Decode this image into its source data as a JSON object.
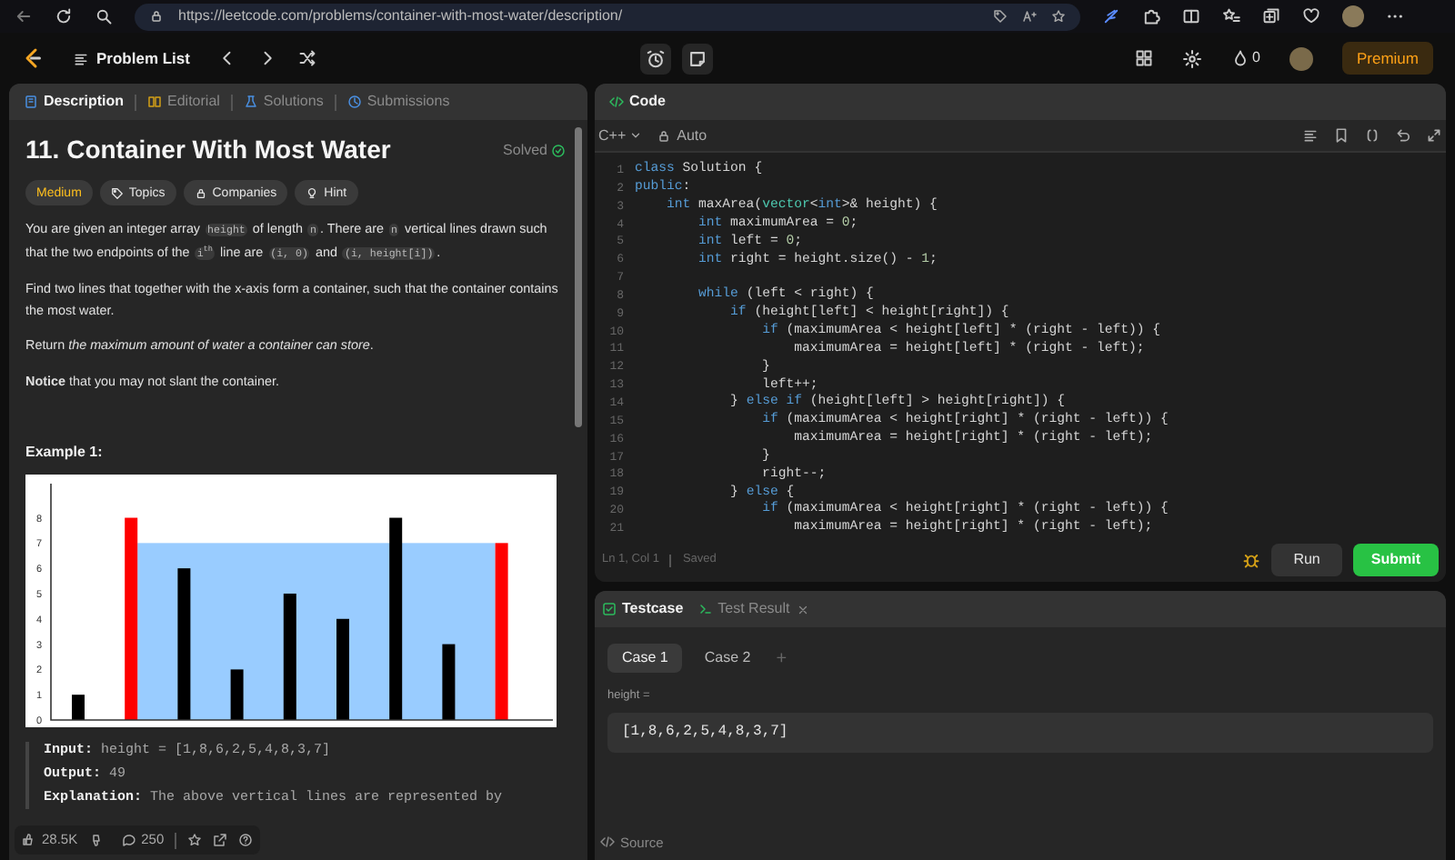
{
  "browser": {
    "url": "https://leetcode.com/problems/container-with-most-water/description/"
  },
  "nav": {
    "problem_list": "Problem List",
    "streak": "0",
    "premium": "Premium"
  },
  "description_tabs": [
    {
      "label": "Description",
      "selected": true
    },
    {
      "label": "Editorial",
      "selected": false
    },
    {
      "label": "Solutions",
      "selected": false
    },
    {
      "label": "Submissions",
      "selected": false
    }
  ],
  "problem": {
    "title": "11. Container With Most Water",
    "status": "Solved",
    "tags": [
      {
        "label": "Medium",
        "kind": "difficulty"
      },
      {
        "label": "Topics",
        "kind": "tag"
      },
      {
        "label": "Companies",
        "kind": "tag"
      },
      {
        "label": "Hint",
        "kind": "tag"
      }
    ],
    "paragraphs": [
      [
        {
          "kind": "text",
          "text": "You are given an integer array "
        },
        {
          "kind": "code",
          "text": "height"
        },
        {
          "kind": "text",
          "text": " of length "
        },
        {
          "kind": "code",
          "text": "n"
        },
        {
          "kind": "text",
          "text": ". There are "
        },
        {
          "kind": "code",
          "text": "n"
        },
        {
          "kind": "text",
          "text": " vertical lines drawn such that the two endpoints of the "
        },
        {
          "kind": "code",
          "text": "i$^{th}$"
        },
        {
          "kind": "text",
          "text": " line are "
        },
        {
          "kind": "code",
          "text": "(i, 0)"
        },
        {
          "kind": "text",
          "text": " and "
        },
        {
          "kind": "code",
          "text": "(i, height[i])"
        },
        {
          "kind": "text",
          "text": "."
        }
      ],
      [
        {
          "kind": "text",
          "text": "Find two lines that together with the x-axis form a container, such that the container contains the most water."
        }
      ],
      [
        {
          "kind": "text",
          "text": "Return *the maximum amount of water a container can store*."
        }
      ],
      [
        {
          "kind": "text",
          "text": "**Notice** that you may not slant the container."
        }
      ]
    ],
    "example": {
      "heading": "Example 1:",
      "chart_data": {
        "type": "bar",
        "ylim": [
          0,
          9.35
        ],
        "yticks": [
          0,
          1,
          2,
          3,
          4,
          5,
          6,
          7,
          8
        ],
        "series": [
          {
            "color": "#000000",
            "values": [
              1,
              null,
              6,
              2,
              5,
              4,
              8,
              3,
              null
            ]
          },
          {
            "color": "#ff0000",
            "values": [
              null,
              8,
              null,
              null,
              null,
              null,
              null,
              null,
              7
            ]
          }
        ]
      },
      "lines": [
        {
          "label": "Input:",
          "text": "height = [1,8,6,2,5,4,8,3,7]"
        },
        {
          "label": "Output:",
          "text": "49"
        },
        {
          "label": "Explanation:",
          "text": "The above vertical lines are represented by"
        }
      ]
    }
  },
  "footer": {
    "likes": "28.5K",
    "comments": "250"
  },
  "code_panel": {
    "title": "Code",
    "language": "C++",
    "mode": "Auto",
    "lines": [
      {
        "number": "1",
        "text": "class Solution {"
      },
      {
        "number": "2",
        "text": "public:"
      },
      {
        "number": "3",
        "text": "    int maxArea(vector<int>& height) {"
      },
      {
        "number": "4",
        "text": "        int maximumArea = 0;"
      },
      {
        "number": "5",
        "text": "        int left = 0;"
      },
      {
        "number": "6",
        "text": "        int right = height.size() - 1;"
      },
      {
        "number": "7"
      },
      {
        "number": "8",
        "text": "        while (left < right) {"
      },
      {
        "number": "9",
        "text": "            if (height[left] < height[right]) {"
      },
      {
        "number": "10",
        "text": "                if (maximumArea < height[left] * (right - left)) {"
      },
      {
        "number": "11",
        "text": "                    maximumArea = height[left] * (right - left);"
      },
      {
        "number": "12",
        "text": "                }"
      },
      {
        "number": "13",
        "text": "                left++;"
      },
      {
        "number": "14",
        "text": "            } else if (height[left] > height[right]) {"
      },
      {
        "number": "15",
        "text": "                if (maximumArea < height[right] * (right - left)) {"
      },
      {
        "number": "16",
        "text": "                    maximumArea = height[right] * (right - left);"
      },
      {
        "number": "17",
        "text": "                }"
      },
      {
        "number": "18",
        "text": "                right--;"
      },
      {
        "number": "19",
        "text": "            } else {"
      },
      {
        "number": "20",
        "text": "                if (maximumArea < height[right] * (right - left)) {"
      },
      {
        "number": "21",
        "text": "                    maximumArea = height[right] * (right - left);"
      }
    ],
    "status": "Ln 1, Col 1",
    "saved": "Saved",
    "run": "Run",
    "submit": "Submit"
  },
  "test_panel": {
    "tabs": [
      {
        "label": "Testcase",
        "selected": true
      },
      {
        "label": "Test Result",
        "selected": false
      }
    ],
    "cases": [
      {
        "label": "Case 1",
        "selected": true
      },
      {
        "label": "Case 2",
        "selected": false
      }
    ],
    "add": "+",
    "param": "height =",
    "value": "[1,8,6,2,5,4,8,3,7]",
    "source": "Source"
  }
}
